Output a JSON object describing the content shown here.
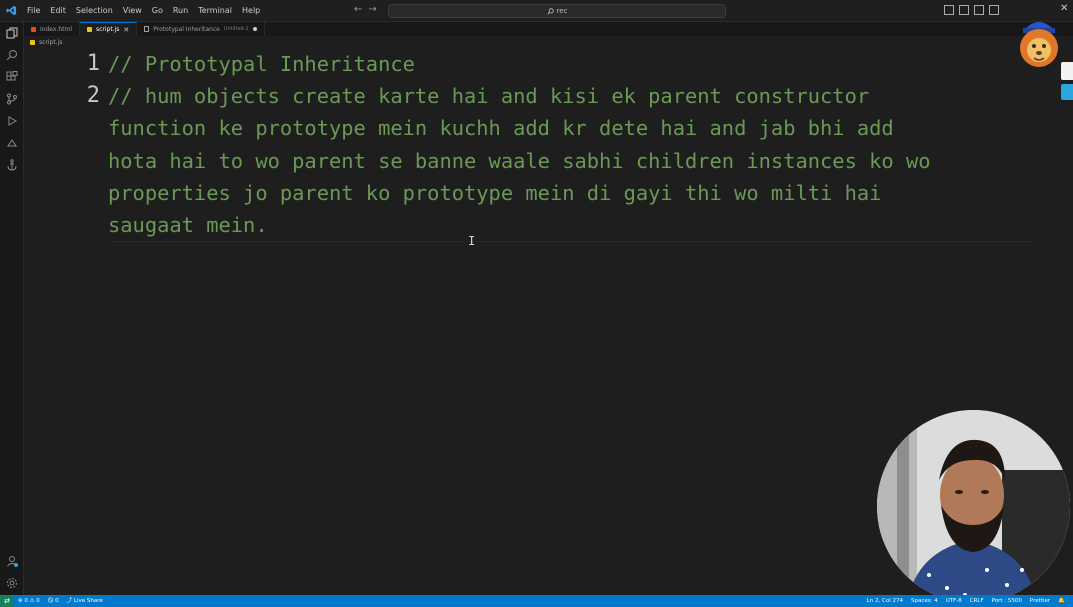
{
  "menu": [
    "File",
    "Edit",
    "Selection",
    "View",
    "Go",
    "Run",
    "Terminal",
    "Help"
  ],
  "search": {
    "text": "rec"
  },
  "tabs": [
    {
      "label": "index.html",
      "type": "html"
    },
    {
      "label": "script.js",
      "type": "js",
      "active": true
    },
    {
      "label": "Prototypal Inheritance",
      "sub": "Untitled-1",
      "type": "doc",
      "dirty": true
    }
  ],
  "breadcrumb": {
    "file": "script.js"
  },
  "editor": {
    "line_numbers": [
      "1",
      "2"
    ],
    "lines": [
      "// Prototypal Inheritance",
      "// hum objects create karte hai and kisi ek parent constructor",
      "function ke prototype mein kuchh add kr dete hai and jab bhi add",
      "hota hai to wo parent se banne waale sabhi children instances ko wo",
      "properties jo parent ko prototype mein di gayi thi wo milti hai",
      "saugaat mein."
    ],
    "cursor_glyph": "I"
  },
  "statusbar": {
    "errors": "0",
    "warnings": "0",
    "ports": "0",
    "live_share": "Live Share",
    "position": "Ln 2, Col 274",
    "spaces": "Spaces: 4",
    "encoding": "UTF-8",
    "eol": "CRLF",
    "port": "Port : 5500",
    "prettier": "Prettier"
  },
  "colors": {
    "comment": "#6a9955",
    "statusbar": "#007acc",
    "accent": "#0078d4"
  }
}
